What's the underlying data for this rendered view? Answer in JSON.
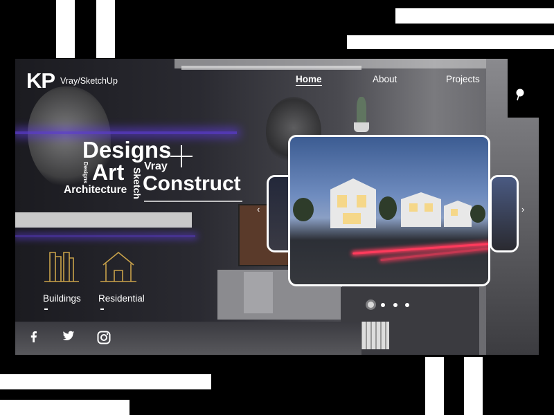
{
  "brand": {
    "logo": "KP",
    "tagline": "Vray/SketchUp"
  },
  "nav": {
    "home": "Home",
    "about": "About",
    "projects": "Projects",
    "active": "Home"
  },
  "wordcloud": {
    "designs": "Designs",
    "art": "Art",
    "vray": "Vray",
    "construct": "Construct",
    "architecture": "Architecture",
    "sketch": "Sketch",
    "designs_small": "Designs"
  },
  "categories": [
    {
      "label": "Buildings",
      "icon": "buildings-icon"
    },
    {
      "label": "Residential",
      "icon": "house-icon"
    }
  ],
  "carousel": {
    "slide_count": 4,
    "active_slide": 1
  },
  "social": [
    "facebook-icon",
    "twitter-icon",
    "instagram-icon"
  ],
  "colors": {
    "accent_gold": "#c9a24a",
    "background": "#000000",
    "text": "#ffffff",
    "light_trail": "#ff3b5c"
  }
}
